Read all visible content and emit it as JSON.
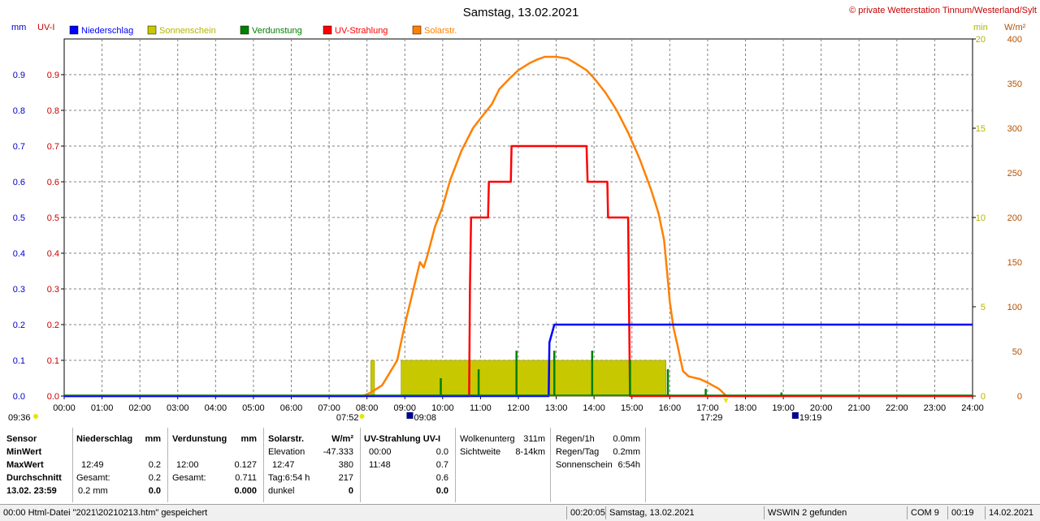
{
  "header": {
    "title": "Samstag, 13.02.2021",
    "copyright": "© private Wetterstation Tinnum/Westerland/Sylt",
    "left_unit_mm": "mm",
    "left_unit_uv": "UV-I",
    "right_unit_min": "min",
    "right_unit_wm2": "W/m²"
  },
  "chart_data": {
    "type": "line",
    "x_axis": {
      "label_ticks": [
        "00:00",
        "01:00",
        "02:00",
        "03:00",
        "04:00",
        "05:00",
        "06:00",
        "07:00",
        "08:00",
        "09:00",
        "10:00",
        "11:00",
        "12:00",
        "13:00",
        "14:00",
        "15:00",
        "16:00",
        "17:00",
        "18:00",
        "19:00",
        "20:00",
        "21:00",
        "22:00",
        "23:00",
        "24:00"
      ],
      "range_hours": [
        0,
        24
      ]
    },
    "y_axis_mm": {
      "range": [
        0,
        1.0
      ],
      "ticks": [
        "0.0",
        "0.1",
        "0.2",
        "0.3",
        "0.4",
        "0.5",
        "0.6",
        "0.7",
        "0.8",
        "0.9"
      ],
      "color": "#0000c8"
    },
    "y_axis_uv": {
      "range": [
        0,
        1.0
      ],
      "ticks": [
        "0.0",
        "0.1",
        "0.2",
        "0.3",
        "0.4",
        "0.5",
        "0.6",
        "0.7",
        "0.8",
        "0.9"
      ],
      "color": "#c80000"
    },
    "y_axis_min": {
      "range": [
        0,
        20
      ],
      "ticks": [
        "0",
        "5",
        "10",
        "15",
        "20"
      ],
      "color": "#b4b400"
    },
    "y_axis_wm2": {
      "range": [
        0,
        400
      ],
      "ticks": [
        "0",
        "50",
        "100",
        "150",
        "200",
        "250",
        "300",
        "350",
        "400"
      ],
      "color": "#b45000"
    },
    "grid": true,
    "legend": [
      {
        "name": "Niederschlag",
        "color": "#0000ff"
      },
      {
        "name": "Sonnenschein",
        "color": "#c8c800"
      },
      {
        "name": "Verdunstung",
        "color": "#008000"
      },
      {
        "name": "UV-Strahlung",
        "color": "#ff0000"
      },
      {
        "name": "Solarstr.",
        "color": "#ff8000"
      }
    ],
    "series": [
      {
        "name": "Niederschlag",
        "axis": "mm",
        "color": "#0000ff",
        "points": [
          [
            0,
            0
          ],
          [
            12.8,
            0
          ],
          [
            12.82,
            0.15
          ],
          [
            12.95,
            0.2
          ],
          [
            24,
            0.2
          ]
        ]
      },
      {
        "name": "UV-Strahlung",
        "axis": "uv",
        "color": "#ff0000",
        "points": [
          [
            0,
            0
          ],
          [
            10.7,
            0
          ],
          [
            10.72,
            0.3
          ],
          [
            10.75,
            0.5
          ],
          [
            11.2,
            0.5
          ],
          [
            11.22,
            0.6
          ],
          [
            11.8,
            0.6
          ],
          [
            11.82,
            0.7
          ],
          [
            13.8,
            0.7
          ],
          [
            13.83,
            0.6
          ],
          [
            14.35,
            0.6
          ],
          [
            14.37,
            0.5
          ],
          [
            14.9,
            0.5
          ],
          [
            14.92,
            0.3
          ],
          [
            14.95,
            0
          ],
          [
            24,
            0
          ]
        ]
      },
      {
        "name": "Solarstr.",
        "axis": "wm2",
        "color": "#ff8000",
        "points": [
          [
            0,
            0
          ],
          [
            7.9,
            0
          ],
          [
            8.1,
            4
          ],
          [
            8.4,
            12
          ],
          [
            8.8,
            40
          ],
          [
            9.0,
            80
          ],
          [
            9.2,
            115
          ],
          [
            9.4,
            150
          ],
          [
            9.5,
            144
          ],
          [
            9.6,
            158
          ],
          [
            9.8,
            190
          ],
          [
            10.0,
            212
          ],
          [
            10.2,
            242
          ],
          [
            10.5,
            275
          ],
          [
            10.8,
            300
          ],
          [
            11.0,
            311
          ],
          [
            11.3,
            327
          ],
          [
            11.5,
            344
          ],
          [
            11.8,
            357
          ],
          [
            12.0,
            365
          ],
          [
            12.3,
            373
          ],
          [
            12.5,
            377
          ],
          [
            12.7,
            380
          ],
          [
            13.0,
            380
          ],
          [
            13.3,
            378
          ],
          [
            13.5,
            373
          ],
          [
            13.8,
            365
          ],
          [
            14.0,
            356
          ],
          [
            14.3,
            340
          ],
          [
            14.6,
            320
          ],
          [
            14.9,
            295
          ],
          [
            15.2,
            266
          ],
          [
            15.5,
            232
          ],
          [
            15.7,
            205
          ],
          [
            15.85,
            175
          ],
          [
            15.95,
            130
          ],
          [
            16.0,
            106
          ],
          [
            16.1,
            76
          ],
          [
            16.2,
            58
          ],
          [
            16.35,
            28
          ],
          [
            16.5,
            22
          ],
          [
            16.8,
            19
          ],
          [
            17.0,
            15
          ],
          [
            17.3,
            8
          ],
          [
            17.5,
            0
          ],
          [
            24,
            0
          ]
        ]
      }
    ],
    "bars": [
      {
        "name": "Sonnenschein",
        "axis": "min",
        "color": "#c8c800",
        "segments": [
          [
            8.1,
            8.2,
            2.0
          ],
          [
            8.9,
            15.9,
            2.0
          ]
        ]
      },
      {
        "name": "Verdunstung",
        "axis": "mm",
        "color": "#008000",
        "spikes": [
          [
            9.95,
            0.05
          ],
          [
            10.95,
            0.075
          ],
          [
            11.95,
            0.127
          ],
          [
            12.95,
            0.127
          ],
          [
            13.95,
            0.127
          ],
          [
            14.95,
            0.1
          ],
          [
            15.95,
            0.075
          ],
          [
            16.95,
            0.02
          ],
          [
            18.95,
            0.01
          ]
        ]
      }
    ],
    "below_axis": {
      "left_time": "09:36",
      "sunrise": "07:52",
      "moon_rise": "09:08",
      "sunset": "17:29",
      "moon_set": "19:19"
    }
  },
  "table": {
    "col1": {
      "title": "Sensor",
      "r1": "MinWert",
      "r2": "MaxWert",
      "r3": "Durchschnitt",
      "r4": "13.02. 23:59"
    },
    "col2": {
      "title": "Niederschlag",
      "unit": "mm",
      "r2_time": "12:49",
      "r2_val": "0.2",
      "r3_label": "Gesamt:",
      "r3_val": "0.2",
      "r4_label": "0.2 mm",
      "r4_val": "0.0"
    },
    "col3": {
      "title": "Verdunstung",
      "unit": "mm",
      "r2_time": "12:00",
      "r2_val": "0.127",
      "r3_label": "Gesamt:",
      "r3_val": "0.711",
      "r4_val": "0.000"
    },
    "col4": {
      "title": "Solarstr.",
      "unit": "W/m²",
      "r1_label": "Elevation",
      "r1_val": "-47.333",
      "r2_time": "12:47",
      "r2_val": "380",
      "r3_label": "Tag:6:54 h",
      "r3_val": "217",
      "r4_label": "dunkel",
      "r4_val": "0"
    },
    "col5": {
      "title": "UV-Strahlung UV-I",
      "r1_time": "00:00",
      "r1_val": "0.0",
      "r2_time": "11:48",
      "r2_val": "0.7",
      "r3_val": "0.6",
      "r4_val": "0.0"
    },
    "col6": {
      "r0_label": "Wolkenunterg",
      "r0_val": "311m",
      "r1_label": "Sichtweite",
      "r1_val": "8-14km"
    },
    "col7": {
      "r0_label": "Regen/1h",
      "r0_val": "0.0mm",
      "r1_label": "Regen/Tag",
      "r1_val": "0.2mm",
      "r2_label": "Sonnenschein",
      "r2_val": "6:54h"
    }
  },
  "statusbar": {
    "left": "00:00  Html-Datei  \"2021\\20210213.htm\"  gespeichert",
    "time": "00:20:05",
    "date": "Samstag, 13.02.2021",
    "wswin": "WSWIN 2 gefunden",
    "com": "COM 9",
    "clock": "00:19",
    "date2": "14.02.2021"
  }
}
